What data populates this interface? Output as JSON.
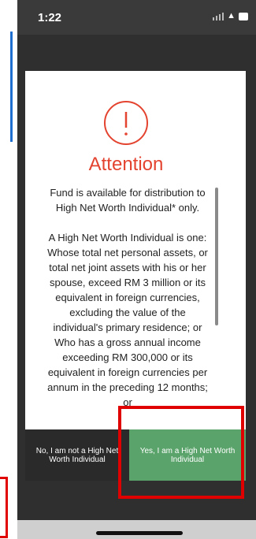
{
  "status_bar": {
    "time": "1:22"
  },
  "dialog": {
    "icon": "alert-circle-icon",
    "title": "Attention",
    "paragraph_1": "Fund is available for distribution to High Net Worth Individual* only.",
    "paragraph_2": "A High Net Worth Individual is one: Whose total net personal assets, or total net joint assets with his or her spouse, exceed RM 3 million or its equivalent in foreign currencies, excluding the value of the individual's primary residence; or Who has a gross annual income exceeding RM 300,000 or its equivalent in foreign currencies per annum in the preceding 12 months; or",
    "no_button": "No, I am not a High Net Worth Individual",
    "yes_button": "Yes, I am a High Net Worth Individual"
  },
  "colors": {
    "accent": "#e3432f",
    "yes_button": "#5aa36b",
    "no_button": "#2a2a2a",
    "highlight": "#e00000"
  }
}
